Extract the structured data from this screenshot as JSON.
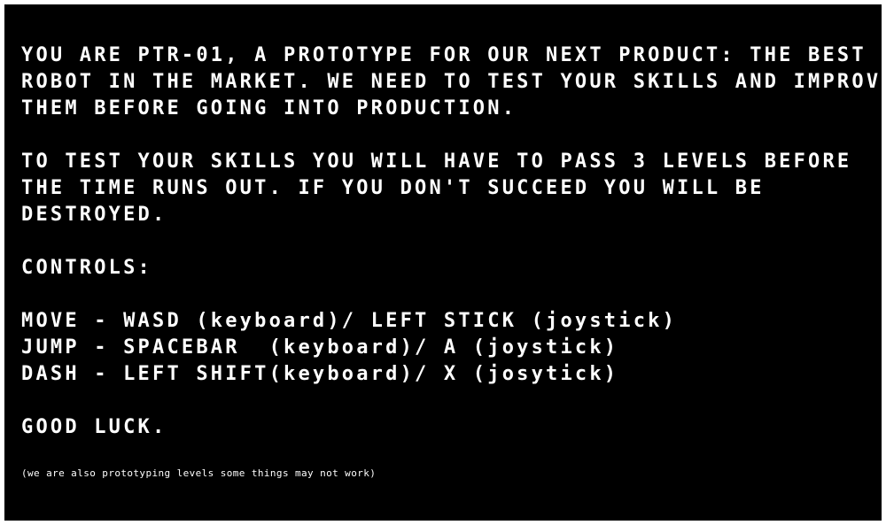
{
  "intro": {
    "lines": [
      "YOU ARE PTR-01, A PROTOTYPE FOR OUR NEXT PRODUCT: THE BEST",
      "ROBOT IN THE MARKET. WE NEED TO TEST YOUR SKILLS AND IMPROVE",
      "THEM BEFORE GOING INTO PRODUCTION."
    ]
  },
  "mission": {
    "lines": [
      "TO TEST YOUR SKILLS YOU WILL HAVE TO PASS 3 LEVELS BEFORE",
      "THE TIME RUNS OUT. IF YOU DON'T SUCCEED YOU WILL BE",
      "DESTROYED."
    ]
  },
  "controls": {
    "heading": "CONTROLS:",
    "move": "MOVE - WASD (keyboard)/ LEFT STICK (joystick)",
    "jump": "JUMP - SPACEBAR  (keyboard)/ A (joystick)",
    "dash": "DASH - LEFT SHIFT(keyboard)/ X (josytick)"
  },
  "closing": "GOOD LUCK.",
  "footnote": "(we are also prototyping levels some things may not work)"
}
